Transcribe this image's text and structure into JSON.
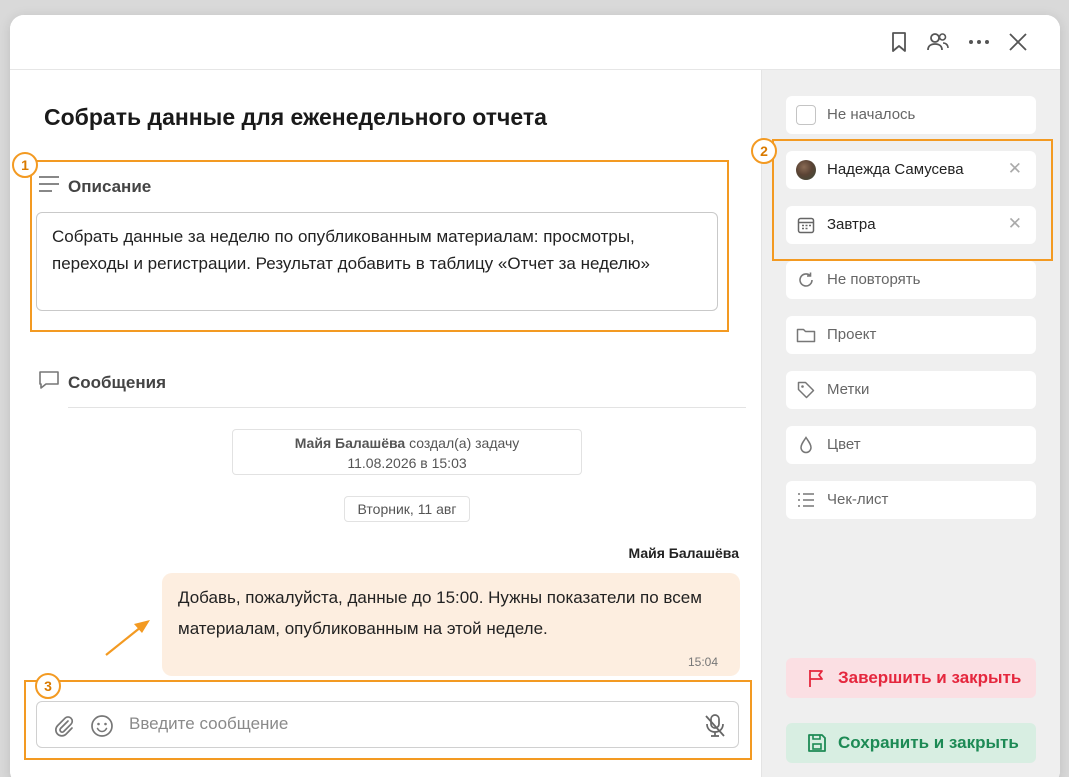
{
  "task": {
    "title": "Собрать данные для еженедельного отчета"
  },
  "description": {
    "heading": "Описание",
    "text": "Собрать данные за неделю по опубликованным материалам: просмотры, переходы и регистрации. Результат добавить в таблицу «Отчет за неделю»"
  },
  "messages": {
    "heading": "Сообщения",
    "system_author": "Майя Балашёва",
    "system_action": " создал(а) задачу",
    "system_date": "11.08.2026 в 15:03",
    "day_chip": "Вторник, 11 авг",
    "author": "Майя Балашёва",
    "text": "Добавь, пожалуйста, данные до 15:00. Нужны показатели по всем материалам, опубликованным на этой неделе.",
    "time": "15:04"
  },
  "composer": {
    "placeholder": "Введите сообщение"
  },
  "sidebar": {
    "status": "Не началось",
    "assignee": "Надежда Самусева",
    "due": "Завтра",
    "repeat": "Не повторять",
    "project": "Проект",
    "tags": "Метки",
    "color": "Цвет",
    "checklist": "Чек-лист",
    "clear_symbol": "✕",
    "finish_label": "Завершить и закрыть",
    "save_label": "Сохранить и закрыть"
  },
  "annotations": {
    "badge1": "1",
    "badge2": "2",
    "badge3": "3",
    "color": "#f39a22"
  },
  "colors": {
    "finish_bg": "#fbdfe3",
    "finish_text": "#e5273e",
    "save_bg": "#d8eee2",
    "save_text": "#1d8a55",
    "bubble_bg": "#fdeee0"
  },
  "icons": [
    "bookmark-icon",
    "users-icon",
    "more-icon",
    "close-icon",
    "lines-icon",
    "chat-icon",
    "paperclip-icon",
    "emoji-icon",
    "mic-off-icon",
    "repeat-icon",
    "folder-icon",
    "tag-icon",
    "drop-icon",
    "checklist-icon",
    "calendar-icon",
    "flag-icon",
    "save-icon"
  ]
}
